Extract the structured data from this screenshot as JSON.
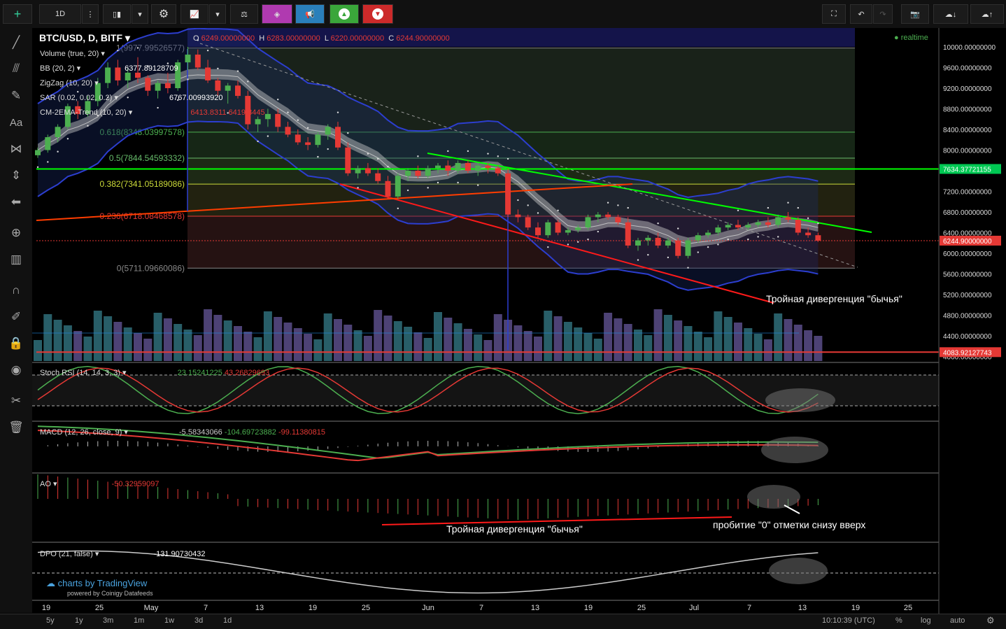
{
  "toolbar": {
    "interval": "1D",
    "buttons": [
      "cursor-icon",
      "interval",
      "bar-style-icon",
      "settings-icon",
      "indicators-icon",
      "compare-icon",
      "cube-icon",
      "megaphone-icon",
      "up-icon",
      "down-icon",
      "fullscreen-icon",
      "undo-icon",
      "redo-icon",
      "camera-icon",
      "cloud-download-icon",
      "cloud-upload-icon"
    ]
  },
  "left_tools": [
    "crosshair-icon",
    "trendline-icon",
    "pitchfork-icon",
    "brush-icon",
    "text-icon",
    "pattern-icon",
    "measure-icon",
    "arrow-left-icon",
    "zoom-icon",
    "bars-icon",
    "magnet-icon",
    "draw-lock-icon",
    "lock-icon",
    "eye-icon",
    "remove-tools-icon",
    "trash-icon"
  ],
  "header": {
    "symbol": "BTC/USD, D, BITF",
    "o_label": "O",
    "o": "6249.00000000",
    "h_label": "H",
    "h": "6283.00000000",
    "l_label": "L",
    "l": "6220.00000000",
    "c_label": "C",
    "c": "6244.90000000",
    "realtime": "realtime"
  },
  "indicators_main": [
    {
      "name": "Volume (true, 20)"
    },
    {
      "name": "BB (20, 2)",
      "value": "6377.89128709"
    },
    {
      "name": "ZigZag (10, 20)"
    },
    {
      "name": "SAR (0.02, 0.02, 0.2)",
      "value": "6767.00993920"
    },
    {
      "name": "CM-2EMA-Trend (10, 20)",
      "value": "6413.8311 6419.3445"
    }
  ],
  "fib_levels": [
    {
      "label": "1(9977.99526577)",
      "price": 9977.99526577,
      "color": "#888888"
    },
    {
      "label": "0.618(8348.03997578)",
      "price": 8348.03997578,
      "color": "#4caf50"
    },
    {
      "label": "0.5(7844.54593332)",
      "price": 7844.54593332,
      "color": "#66bb6a"
    },
    {
      "label": "0.382(7341.05189086)",
      "price": 7341.05189086,
      "color": "#cddc39"
    },
    {
      "label": "0.236(6718.08468578)",
      "price": 6718.08468578,
      "color": "#e53935"
    },
    {
      "label": "0(5711.09660086)",
      "price": 5711.09660086,
      "color": "#888888"
    }
  ],
  "price_axis": [
    "10400.00000000",
    "10000.00000000",
    "9600.00000000",
    "9200.00000000",
    "8800.00000000",
    "8400.00000000",
    "8000.00000000",
    "7600.00000000",
    "7200.00000000",
    "6800.00000000",
    "6400.00000000",
    "6000.00000000",
    "5600.00000000",
    "5200.00000000",
    "4800.00000000",
    "4400.00000000",
    "4000.00000000"
  ],
  "price_tags": [
    {
      "text": "7634.37721155",
      "price": 7634.37721155,
      "color": "#00c853"
    },
    {
      "text": "6244.90000000",
      "price": 6244.9,
      "color": "#e53935"
    },
    {
      "text": "4083.92127743",
      "price": 4083.92127743,
      "color": "#e53935"
    }
  ],
  "annotations": {
    "main": "Тройная дивергенция \"бычья\"",
    "ao": "Тройная дивергенция \"бычья\"",
    "ao_zero": "пробитие \"0\" отметки снизу вверх"
  },
  "panes": {
    "stoch": {
      "name": "Stoch RSI (14, 14, 3, 3)",
      "k": "23.15241225",
      "d": "43.26829693",
      "axis": [
        "80.00000000",
        "40.00000000",
        "0.00000000"
      ]
    },
    "macd": {
      "name": "MACD (12, 26, close, 9)",
      "hist": "-5.58343066",
      "macd": "-104.69723882",
      "signal": "-99.11380815",
      "axis": [
        "400.00000000",
        "0.00000000",
        "-400.00000000"
      ]
    },
    "ao": {
      "name": "AO",
      "value": "-50.32959097",
      "axis": [
        "1000.00000000",
        "0.00000000",
        "-1000.00000000",
        "-2000.00000000"
      ]
    },
    "dpo": {
      "name": "DPO (21, false)",
      "value": "-131.90730432",
      "axis": [
        "2000.00000000",
        "0.00000000",
        "-2000.00000000"
      ]
    }
  },
  "watermark": {
    "brand": "charts by TradingView",
    "powered": "powered by Coinigy Datafeeds"
  },
  "time_axis": [
    "19",
    "25",
    "May",
    "7",
    "13",
    "19",
    "25",
    "Jun",
    "7",
    "13",
    "19",
    "25",
    "Jul",
    "7",
    "13",
    "19",
    "25"
  ],
  "bottom": {
    "ranges": [
      "5y",
      "1y",
      "3m",
      "1m",
      "1w",
      "3d",
      "1d"
    ],
    "clock": "10:10:39 (UTC)",
    "pct": "%",
    "log": "log",
    "auto": "auto"
  },
  "chart_data": {
    "type": "candlestick",
    "symbol": "BTC/USD",
    "ylim": [
      4000,
      10400
    ],
    "candles": [
      {
        "o": 7900,
        "h": 8050,
        "l": 7850,
        "c": 8000
      },
      {
        "o": 8000,
        "h": 8300,
        "l": 7950,
        "c": 8250
      },
      {
        "o": 8250,
        "h": 8500,
        "l": 8150,
        "c": 8450
      },
      {
        "o": 8450,
        "h": 8900,
        "l": 8400,
        "c": 8850
      },
      {
        "o": 8850,
        "h": 8950,
        "l": 8600,
        "c": 8700
      },
      {
        "o": 8700,
        "h": 9050,
        "l": 8650,
        "c": 8950
      },
      {
        "o": 8950,
        "h": 9400,
        "l": 8850,
        "c": 9300
      },
      {
        "o": 9300,
        "h": 9700,
        "l": 9200,
        "c": 9600
      },
      {
        "o": 9600,
        "h": 9750,
        "l": 9250,
        "c": 9350
      },
      {
        "o": 9350,
        "h": 9600,
        "l": 9200,
        "c": 9500
      },
      {
        "o": 9500,
        "h": 9800,
        "l": 9300,
        "c": 9400
      },
      {
        "o": 9400,
        "h": 9450,
        "l": 9050,
        "c": 9150
      },
      {
        "o": 9150,
        "h": 9350,
        "l": 9000,
        "c": 9300
      },
      {
        "o": 9300,
        "h": 9500,
        "l": 9100,
        "c": 9200
      },
      {
        "o": 9200,
        "h": 9750,
        "l": 9150,
        "c": 9700
      },
      {
        "o": 9700,
        "h": 10000,
        "l": 9550,
        "c": 9850
      },
      {
        "o": 9850,
        "h": 9950,
        "l": 9550,
        "c": 9600
      },
      {
        "o": 9600,
        "h": 9750,
        "l": 9300,
        "c": 9350
      },
      {
        "o": 9350,
        "h": 9400,
        "l": 9050,
        "c": 9150
      },
      {
        "o": 9150,
        "h": 9300,
        "l": 8900,
        "c": 9250
      },
      {
        "o": 9250,
        "h": 9350,
        "l": 9000,
        "c": 9050
      },
      {
        "o": 9050,
        "h": 9150,
        "l": 8400,
        "c": 8500
      },
      {
        "o": 8500,
        "h": 8650,
        "l": 8350,
        "c": 8600
      },
      {
        "o": 8600,
        "h": 8800,
        "l": 8450,
        "c": 8700
      },
      {
        "o": 8700,
        "h": 8800,
        "l": 8350,
        "c": 8450
      },
      {
        "o": 8450,
        "h": 8550,
        "l": 8250,
        "c": 8300
      },
      {
        "o": 8300,
        "h": 8400,
        "l": 8100,
        "c": 8150
      },
      {
        "o": 8150,
        "h": 8250,
        "l": 8000,
        "c": 8100
      },
      {
        "o": 8100,
        "h": 8350,
        "l": 8050,
        "c": 8300
      },
      {
        "o": 8300,
        "h": 8500,
        "l": 8200,
        "c": 8450
      },
      {
        "o": 8450,
        "h": 8550,
        "l": 8000,
        "c": 8050
      },
      {
        "o": 8050,
        "h": 8150,
        "l": 7500,
        "c": 7550
      },
      {
        "o": 7550,
        "h": 7700,
        "l": 7450,
        "c": 7650
      },
      {
        "o": 7650,
        "h": 7750,
        "l": 7500,
        "c": 7550
      },
      {
        "o": 7550,
        "h": 7650,
        "l": 7350,
        "c": 7400
      },
      {
        "o": 7400,
        "h": 7500,
        "l": 7050,
        "c": 7100
      },
      {
        "o": 7100,
        "h": 7550,
        "l": 7050,
        "c": 7500
      },
      {
        "o": 7500,
        "h": 7650,
        "l": 7400,
        "c": 7600
      },
      {
        "o": 7600,
        "h": 7700,
        "l": 7450,
        "c": 7500
      },
      {
        "o": 7500,
        "h": 7700,
        "l": 7450,
        "c": 7650
      },
      {
        "o": 7650,
        "h": 7750,
        "l": 7550,
        "c": 7700
      },
      {
        "o": 7700,
        "h": 7800,
        "l": 7500,
        "c": 7600
      },
      {
        "o": 7600,
        "h": 7800,
        "l": 7550,
        "c": 7750
      },
      {
        "o": 7750,
        "h": 7800,
        "l": 7550,
        "c": 7600
      },
      {
        "o": 7600,
        "h": 7750,
        "l": 7500,
        "c": 7700
      },
      {
        "o": 7700,
        "h": 7750,
        "l": 7550,
        "c": 7650
      },
      {
        "o": 7650,
        "h": 7700,
        "l": 7500,
        "c": 7550
      },
      {
        "o": 7550,
        "h": 7650,
        "l": 6700,
        "c": 6750
      },
      {
        "o": 6750,
        "h": 6850,
        "l": 6600,
        "c": 6700
      },
      {
        "o": 6700,
        "h": 6750,
        "l": 6450,
        "c": 6500
      },
      {
        "o": 6500,
        "h": 6600,
        "l": 6300,
        "c": 6350
      },
      {
        "o": 6350,
        "h": 6650,
        "l": 6300,
        "c": 6600
      },
      {
        "o": 6600,
        "h": 6650,
        "l": 6350,
        "c": 6400
      },
      {
        "o": 6400,
        "h": 6500,
        "l": 6350,
        "c": 6450
      },
      {
        "o": 6450,
        "h": 6550,
        "l": 6400,
        "c": 6500
      },
      {
        "o": 6500,
        "h": 6750,
        "l": 6450,
        "c": 6700
      },
      {
        "o": 6700,
        "h": 6800,
        "l": 6600,
        "c": 6750
      },
      {
        "o": 6750,
        "h": 6800,
        "l": 6650,
        "c": 6700
      },
      {
        "o": 6700,
        "h": 6750,
        "l": 6550,
        "c": 6600
      },
      {
        "o": 6600,
        "h": 6700,
        "l": 6100,
        "c": 6150
      },
      {
        "o": 6150,
        "h": 6300,
        "l": 6050,
        "c": 6250
      },
      {
        "o": 6250,
        "h": 6350,
        "l": 6150,
        "c": 6300
      },
      {
        "o": 6300,
        "h": 6400,
        "l": 6100,
        "c": 6150
      },
      {
        "o": 6150,
        "h": 6300,
        "l": 6100,
        "c": 6250
      },
      {
        "o": 6250,
        "h": 6300,
        "l": 5900,
        "c": 5950
      },
      {
        "o": 5950,
        "h": 6300,
        "l": 5900,
        "c": 6250
      },
      {
        "o": 6250,
        "h": 6400,
        "l": 6200,
        "c": 6350
      },
      {
        "o": 6350,
        "h": 6450,
        "l": 6300,
        "c": 6400
      },
      {
        "o": 6400,
        "h": 6550,
        "l": 6350,
        "c": 6500
      },
      {
        "o": 6500,
        "h": 6600,
        "l": 6450,
        "c": 6550
      },
      {
        "o": 6550,
        "h": 6650,
        "l": 6450,
        "c": 6500
      },
      {
        "o": 6500,
        "h": 6600,
        "l": 6450,
        "c": 6550
      },
      {
        "o": 6550,
        "h": 6650,
        "l": 6500,
        "c": 6600
      },
      {
        "o": 6600,
        "h": 6700,
        "l": 6500,
        "c": 6550
      },
      {
        "o": 6550,
        "h": 6750,
        "l": 6500,
        "c": 6700
      },
      {
        "o": 6700,
        "h": 6800,
        "l": 6600,
        "c": 6650
      },
      {
        "o": 6650,
        "h": 6700,
        "l": 6350,
        "c": 6400
      },
      {
        "o": 6400,
        "h": 6500,
        "l": 6300,
        "c": 6350
      },
      {
        "o": 6350,
        "h": 6400,
        "l": 6220,
        "c": 6244.9
      }
    ]
  },
  "colors": {
    "up": "#4caf50",
    "down": "#e53935",
    "bb": "#2c3ecf",
    "accent_green": "#00ff00",
    "accent_red": "#ff1a1a"
  }
}
